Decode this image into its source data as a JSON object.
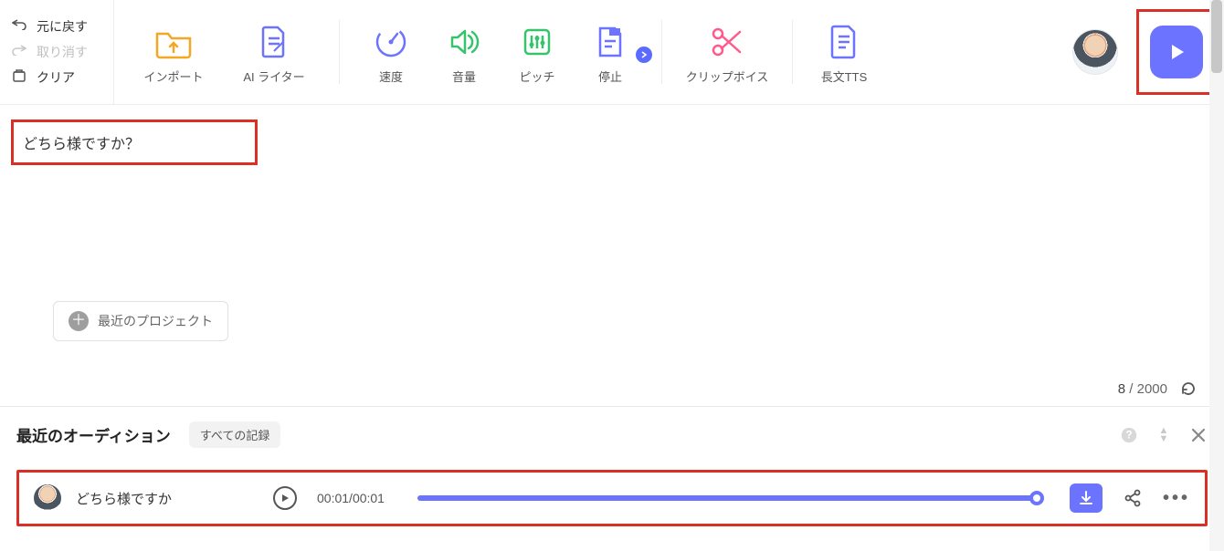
{
  "left_actions": {
    "undo": "元に戻す",
    "redo": "取り消す",
    "clear": "クリア"
  },
  "toolbar": {
    "import": "インポート",
    "ai_writer": "AI ライター",
    "speed": "速度",
    "volume": "音量",
    "pitch": "ピッチ",
    "stop": "停止",
    "clip_voice": "クリップボイス",
    "long_tts": "長文TTS"
  },
  "editor": {
    "text": "どちら様ですか？",
    "recent_projects": "最近のプロジェクト",
    "char_current": "8",
    "char_max": "2000"
  },
  "audition": {
    "title": "最近のオーディション",
    "filter": "すべての記録",
    "row_text": "どちら様ですか",
    "time_current": "00:01",
    "time_total": "00:01"
  },
  "icons": {
    "import": "folder-up-icon",
    "ai_writer": "document-pencil-icon",
    "speed": "gauge-icon",
    "volume": "speaker-icon",
    "pitch": "equalizer-icon",
    "stop": "stop-icon",
    "clip": "scissors-icon",
    "long_tts": "document-lines-icon"
  }
}
